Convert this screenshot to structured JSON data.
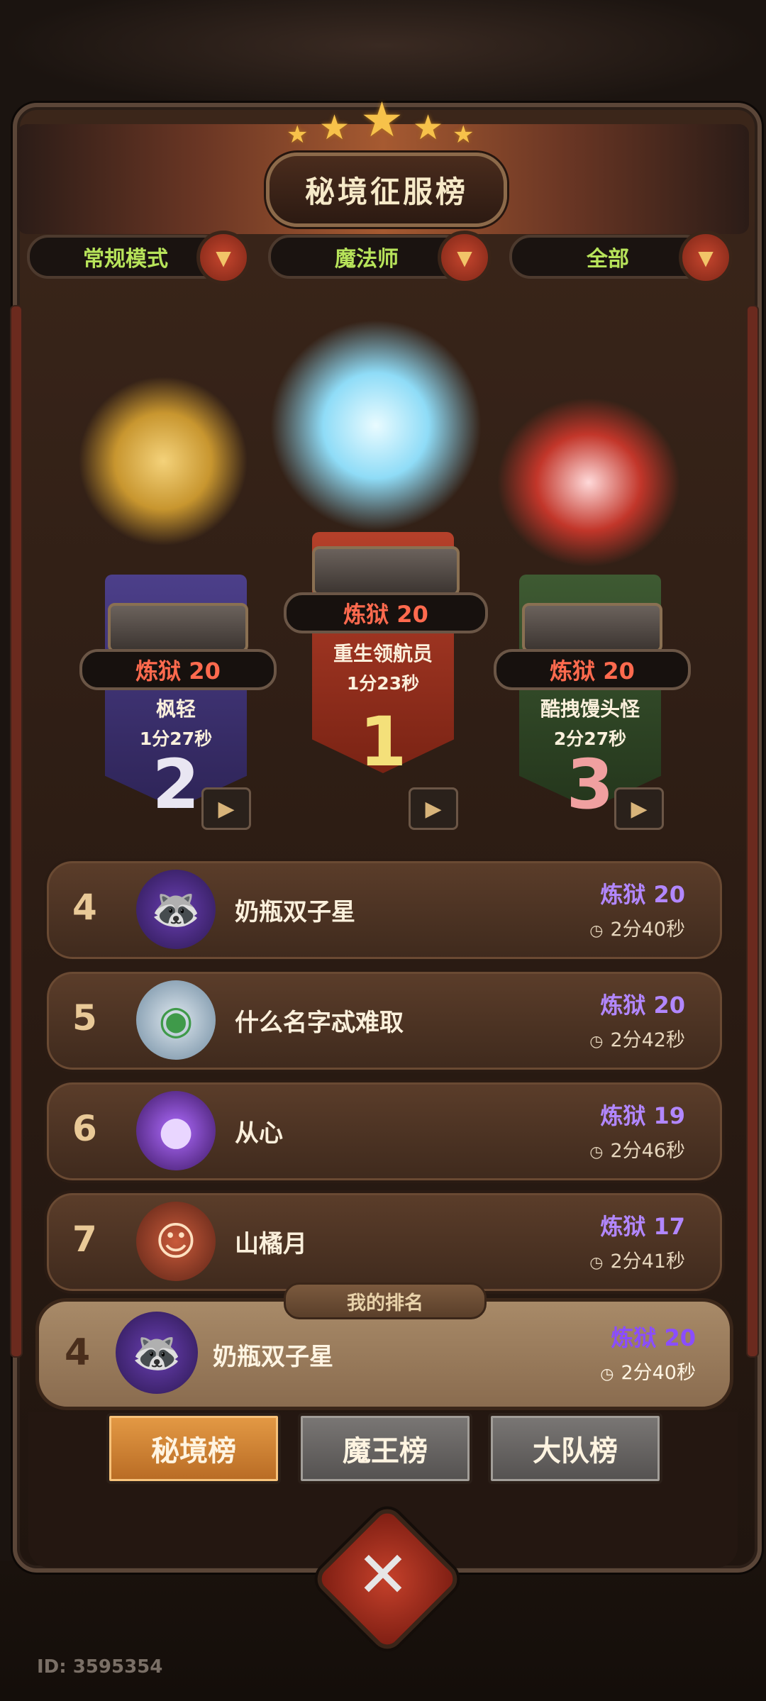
{
  "board": {
    "title": "秘境征服榜",
    "filters": [
      {
        "label": "常规模式"
      },
      {
        "label": "魔法师"
      },
      {
        "label": "全部"
      }
    ]
  },
  "podium": {
    "first": {
      "rank_tag": "炼狱 20",
      "name": "重生领航员",
      "time": "1分23秒",
      "place": "1"
    },
    "second": {
      "rank_tag": "炼狱 20",
      "name": "枫轻",
      "time": "1分27秒",
      "place": "2"
    },
    "third": {
      "rank_tag": "炼狱 20",
      "name": "酷拽馒头怪",
      "time": "2分27秒",
      "place": "3"
    }
  },
  "rows": [
    {
      "rank": "4",
      "name": "奶瓶双子星",
      "level": "炼狱 20",
      "time": "2分40秒",
      "avatar_icon": "raccoon-avatar-icon"
    },
    {
      "rank": "5",
      "name": "什么名字忒难取",
      "level": "炼狱 20",
      "time": "2分42秒",
      "avatar_icon": "astronaut-avatar-icon"
    },
    {
      "rank": "6",
      "name": "从心",
      "level": "炼狱 19",
      "time": "2分46秒",
      "avatar_icon": "purple-orb-avatar-icon"
    },
    {
      "rank": "7",
      "name": "山橘月",
      "level": "炼狱 17",
      "time": "2分41秒",
      "avatar_icon": "clown-avatar-icon"
    }
  ],
  "my_rank": {
    "label": "我的排名",
    "rank": "4",
    "name": "奶瓶双子星",
    "level": "炼狱 20",
    "time": "2分40秒"
  },
  "tabs": [
    {
      "label": "秘境榜",
      "active": true
    },
    {
      "label": "魔王榜",
      "active": false
    },
    {
      "label": "大队榜",
      "active": false
    }
  ],
  "footer": {
    "id_text": "ID: 3595354"
  },
  "colors": {
    "level_purple": "#b287ff",
    "rank_red": "#ff6a4e",
    "filter_green": "#b7e35a",
    "tab_active": "#e49a45"
  }
}
